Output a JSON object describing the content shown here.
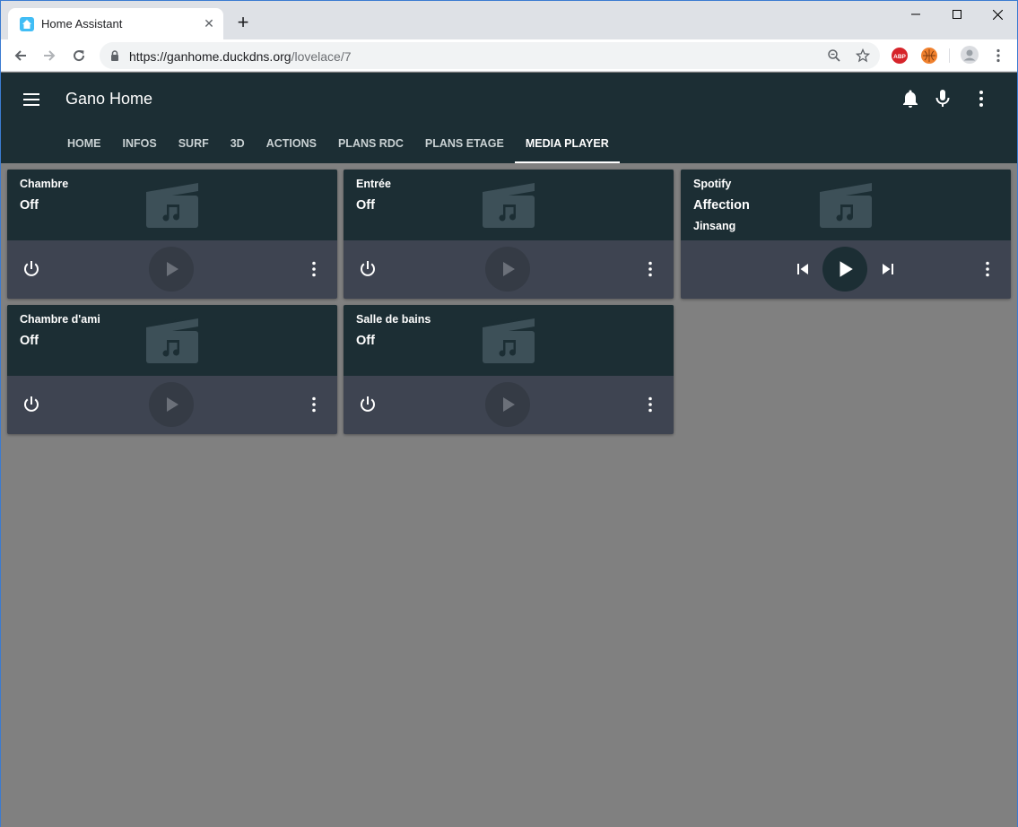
{
  "browser": {
    "tab_title": "Home Assistant",
    "url_host": "https://ganhome.duckdns.org",
    "url_path": "/lovelace/7"
  },
  "app": {
    "title": "Gano Home",
    "tabs": [
      {
        "label": "HOME"
      },
      {
        "label": "INFOS"
      },
      {
        "label": "SURF"
      },
      {
        "label": "3D"
      },
      {
        "label": "ACTIONS"
      },
      {
        "label": "PLANS RDC"
      },
      {
        "label": "PLANS ETAGE"
      },
      {
        "label": "MEDIA PLAYER",
        "active": true
      }
    ]
  },
  "cards": [
    {
      "name": "Chambre",
      "state": "Off"
    },
    {
      "name": "Entrée",
      "state": "Off"
    },
    {
      "name": "Spotify",
      "state": "Affection",
      "artist": "Jinsang"
    },
    {
      "name": "Chambre d'ami",
      "state": "Off"
    },
    {
      "name": "Salle de bains",
      "state": "Off"
    }
  ],
  "colors": {
    "header_bg": "#1c2e34",
    "card_controls_bg": "#3e4451",
    "page_bg": "#808080",
    "ha_blue": "#41bdf5"
  },
  "icons": {
    "media": "movie-music-icon",
    "power": "power-icon",
    "play": "play-icon",
    "more": "dots-vertical-icon"
  }
}
